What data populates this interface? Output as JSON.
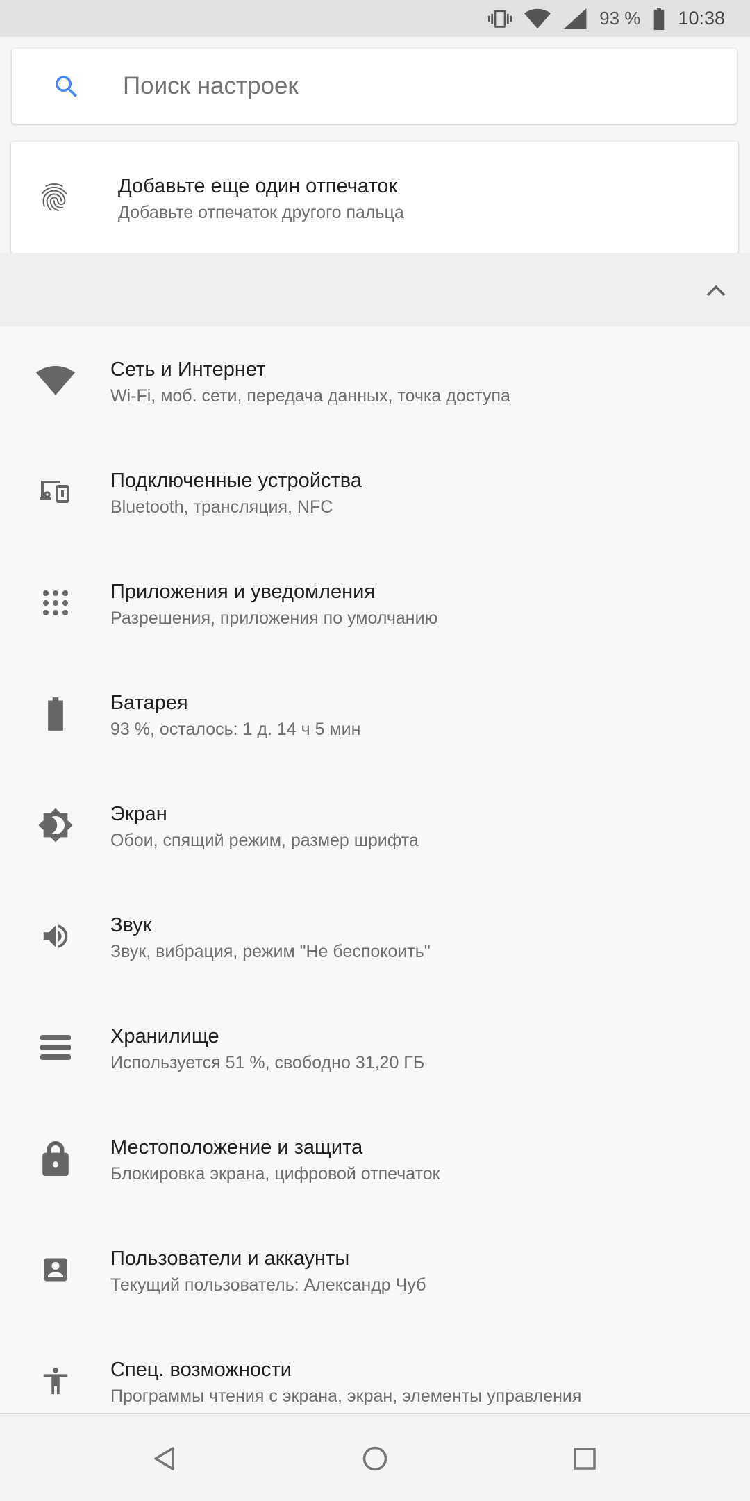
{
  "status_bar": {
    "battery_percent": "93 %",
    "time": "10:38",
    "icons": [
      "vibrate-icon",
      "wifi-icon",
      "signal-icon",
      "battery-icon"
    ]
  },
  "search": {
    "placeholder": "Поиск настроек"
  },
  "suggestion": {
    "title": "Добавьте еще один отпечаток",
    "subtitle": "Добавьте отпечаток другого пальца",
    "icon": "fingerprint-icon"
  },
  "settings": [
    {
      "icon": "wifi-icon",
      "title": "Сеть и Интернет",
      "subtitle": "Wi-Fi, моб. сети, передача данных, точка доступа"
    },
    {
      "icon": "devices-icon",
      "title": "Подключенные устройства",
      "subtitle": "Bluetooth, трансляция, NFC"
    },
    {
      "icon": "apps-icon",
      "title": "Приложения и уведомления",
      "subtitle": "Разрешения, приложения по умолчанию"
    },
    {
      "icon": "battery-icon",
      "title": "Батарея",
      "subtitle": "93 %, осталось: 1 д. 14 ч 5 мин"
    },
    {
      "icon": "brightness-icon",
      "title": "Экран",
      "subtitle": "Обои, спящий режим, размер шрифта"
    },
    {
      "icon": "volume-icon",
      "title": "Звук",
      "subtitle": "Звук, вибрация, режим \"Не беспокоить\""
    },
    {
      "icon": "storage-icon",
      "title": "Хранилище",
      "subtitle": "Используется 51 %, свободно 31,20 ГБ"
    },
    {
      "icon": "lock-icon",
      "title": "Местоположение и защита",
      "subtitle": "Блокировка экрана, цифровой отпечаток"
    },
    {
      "icon": "account-icon",
      "title": "Пользователи и аккаунты",
      "subtitle": "Текущий пользователь: Александр Чуб"
    },
    {
      "icon": "accessibility-icon",
      "title": "Спец. возможности",
      "subtitle": "Программы чтения с экрана, экран, элементы управления"
    }
  ],
  "nav_bar": {
    "buttons": [
      "back-icon",
      "home-icon",
      "recents-icon"
    ]
  },
  "colors": {
    "accent": "#4285f4",
    "icon_gray": "#666666",
    "background": "#f8f8f8"
  }
}
